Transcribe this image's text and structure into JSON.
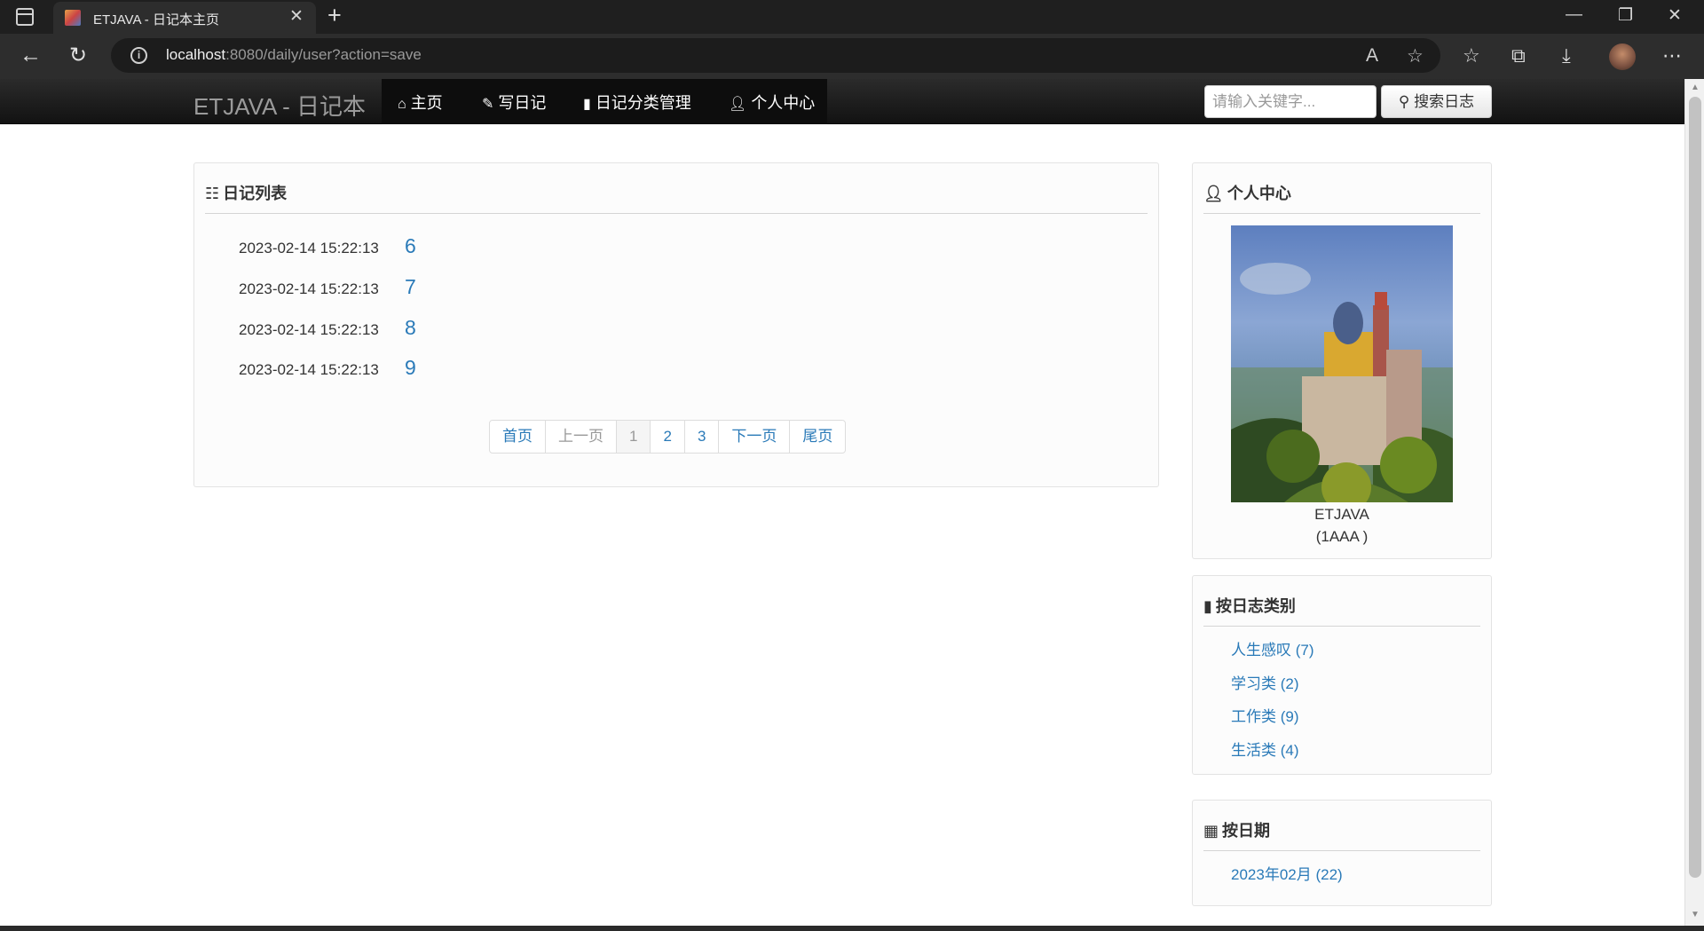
{
  "browser": {
    "tab_title": "ETJAVA - 日记本主页",
    "url_host": "localhost",
    "url_rest": ":8080/daily/user?action=save"
  },
  "navbar": {
    "brand": "ETJAVA - 日记本",
    "items": [
      {
        "label": "主页",
        "icon": "home-icon"
      },
      {
        "label": "写日记",
        "icon": "pencil-icon"
      },
      {
        "label": "日记分类管理",
        "icon": "book-icon"
      },
      {
        "label": "个人中心",
        "icon": "user-icon"
      }
    ],
    "search_placeholder": "请输入关键字...",
    "search_button": "搜索日志"
  },
  "diary_list": {
    "title": "日记列表",
    "entries": [
      {
        "date": "2023-02-14 15:22:13",
        "title": "6"
      },
      {
        "date": "2023-02-14 15:22:13",
        "title": "7"
      },
      {
        "date": "2023-02-14 15:22:13",
        "title": "8"
      },
      {
        "date": "2023-02-14 15:22:13",
        "title": "9"
      }
    ],
    "pagination": [
      "首页",
      "上一页",
      "1",
      "2",
      "3",
      "下一页",
      "尾页"
    ],
    "current_page": "1"
  },
  "profile": {
    "title": "个人中心",
    "name": "ETJAVA",
    "sub": "(1AAA )"
  },
  "categories": {
    "title": "按日志类别",
    "items": [
      {
        "label": "人生感叹",
        "count": "(7)"
      },
      {
        "label": "学习类",
        "count": "(2)"
      },
      {
        "label": "工作类",
        "count": "(9)"
      },
      {
        "label": "生活类",
        "count": "(4)"
      }
    ]
  },
  "dates": {
    "title": "按日期",
    "items": [
      {
        "label": "2023年02月",
        "count": "(22)"
      }
    ]
  },
  "colors": {
    "link": "#2a7ab8",
    "navbar": "#1b1b1b",
    "panel_bg": "#fcfcfc"
  }
}
